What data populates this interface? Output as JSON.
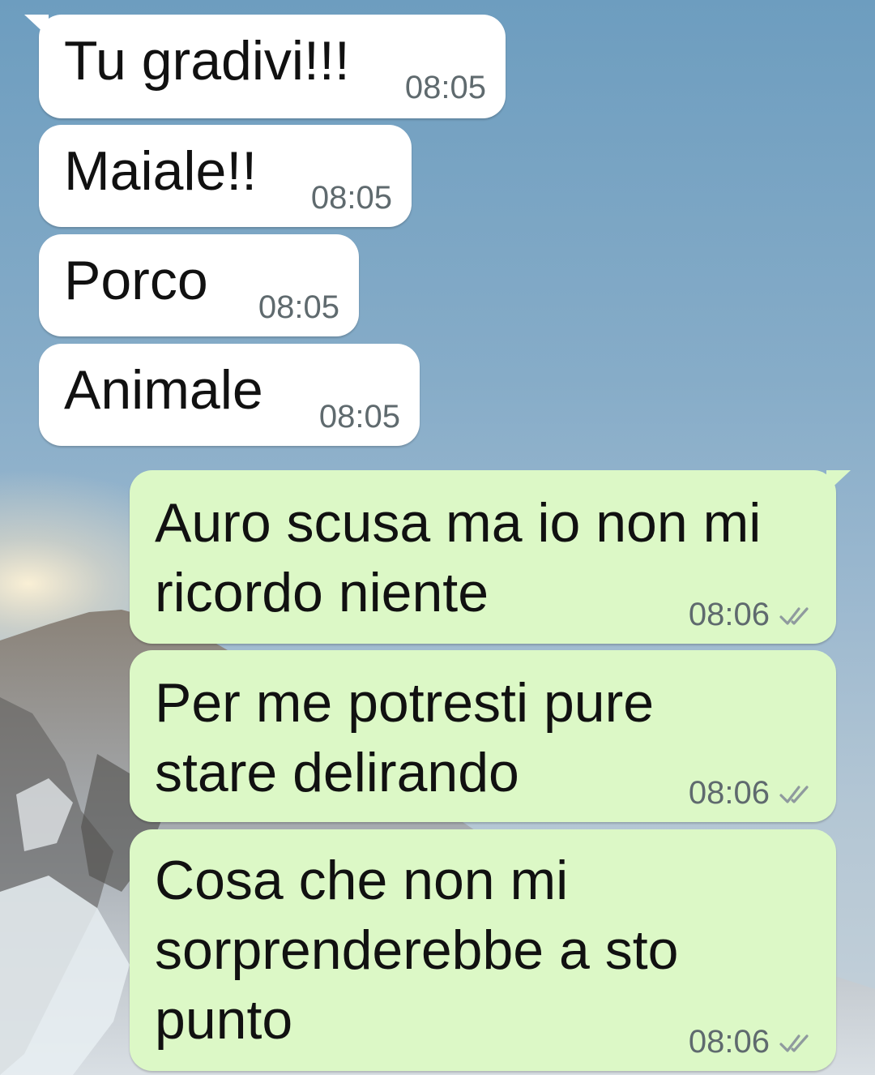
{
  "chat": {
    "messages": [
      {
        "direction": "incoming",
        "text": "Tu gradivi!!!",
        "time": "08:05"
      },
      {
        "direction": "incoming",
        "text": "Maiale!!",
        "time": "08:05"
      },
      {
        "direction": "incoming",
        "text": "Porco",
        "time": "08:05"
      },
      {
        "direction": "incoming",
        "text": "Animale",
        "time": "08:05"
      },
      {
        "direction": "outgoing",
        "text_lines": [
          "Auro scusa ma io non mi",
          "ricordo niente"
        ],
        "time": "08:06",
        "status_icon": "double-check-icon"
      },
      {
        "direction": "outgoing",
        "text_lines": [
          "Per me potresti pure",
          "stare delirando"
        ],
        "time": "08:06",
        "status_icon": "double-check-icon"
      },
      {
        "direction": "outgoing",
        "text_lines": [
          "Cosa che non mi",
          "sorprenderebbe a sto",
          "punto"
        ],
        "time": "08:06",
        "status_icon": "double-check-icon"
      }
    ]
  },
  "colors": {
    "incoming_bubble": "#ffffff",
    "outgoing_bubble": "#dcf8c6",
    "timestamp": "#5f6a6e",
    "wallpaper_sky": "#7fa7c6"
  }
}
